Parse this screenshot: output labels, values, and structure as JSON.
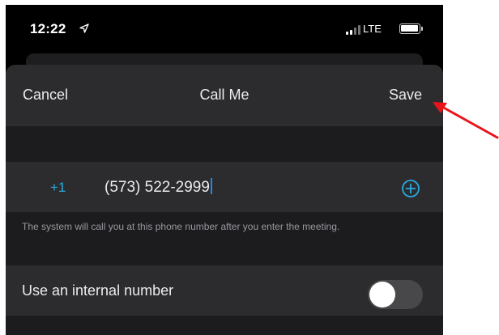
{
  "status_bar": {
    "time": "12:22",
    "carrier": "LTE",
    "icons": [
      "location-arrow-icon",
      "signal-bars-icon",
      "battery-icon"
    ]
  },
  "nav": {
    "cancel_label": "Cancel",
    "title": "Call Me",
    "save_label": "Save"
  },
  "phone_entry": {
    "country_code": "+1",
    "value": "(573) 522-2999",
    "add_icon": "plus-circle-icon"
  },
  "helper_text": "The system will call you at this phone number after you enter the meeting.",
  "internal_number": {
    "label": "Use an internal number",
    "toggle_on": false
  },
  "annotation": {
    "icon": "red-arrow-icon",
    "color": "#e8141a"
  },
  "colors": {
    "accent": "#29a8e0",
    "caret": "#1f8ae8",
    "sheet_bg": "#2c2c2e",
    "group_bg": "#1c1c1e"
  }
}
